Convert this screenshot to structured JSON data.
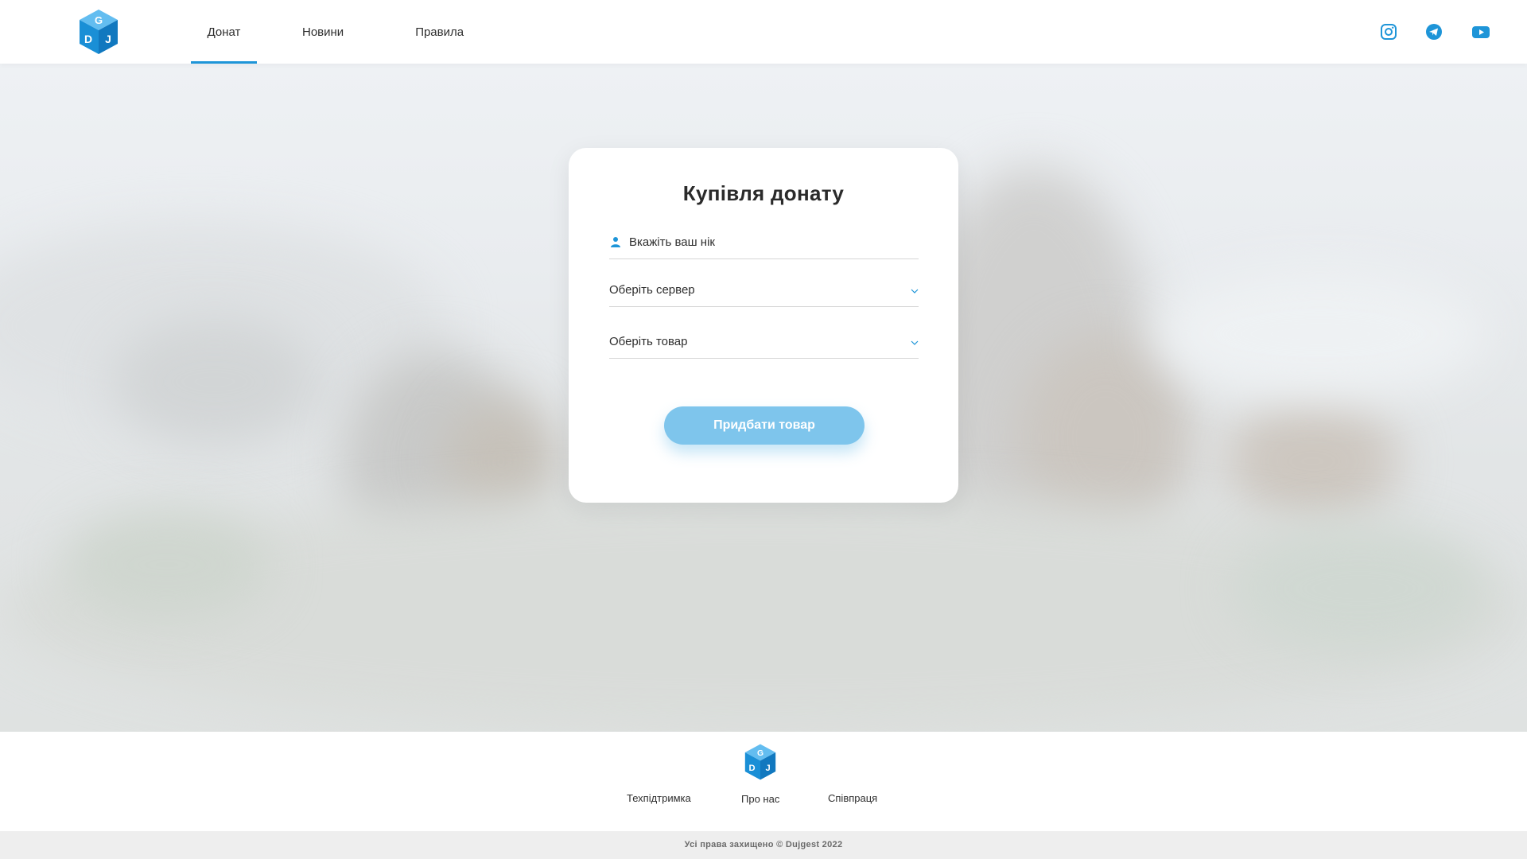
{
  "header": {
    "logo_icon": "dujgest-cube-logo",
    "logo_letters": [
      "G",
      "D",
      "J"
    ],
    "nav": [
      {
        "label": "Донат",
        "active": true
      },
      {
        "label": "Новини",
        "active": false
      },
      {
        "label": "Правила",
        "active": false
      }
    ],
    "socials": [
      "instagram-icon",
      "telegram-icon",
      "youtube-icon"
    ]
  },
  "card": {
    "title": "Купівля донату",
    "nick_placeholder": "Вкажіть ваш нік",
    "server_select": "Оберіть сервер",
    "product_select": "Оберіть товар",
    "buy_button": "Придбати товар"
  },
  "footer": {
    "links": [
      "Техпідтримка",
      "Про нас",
      "Співпраця"
    ],
    "copyright": "Усі права захищено © Dujgest 2022"
  },
  "colors": {
    "accent": "#1e95d8",
    "button": "#7ec5ec",
    "text": "#2b2b2b",
    "copyright_bg": "#eeeeee"
  }
}
